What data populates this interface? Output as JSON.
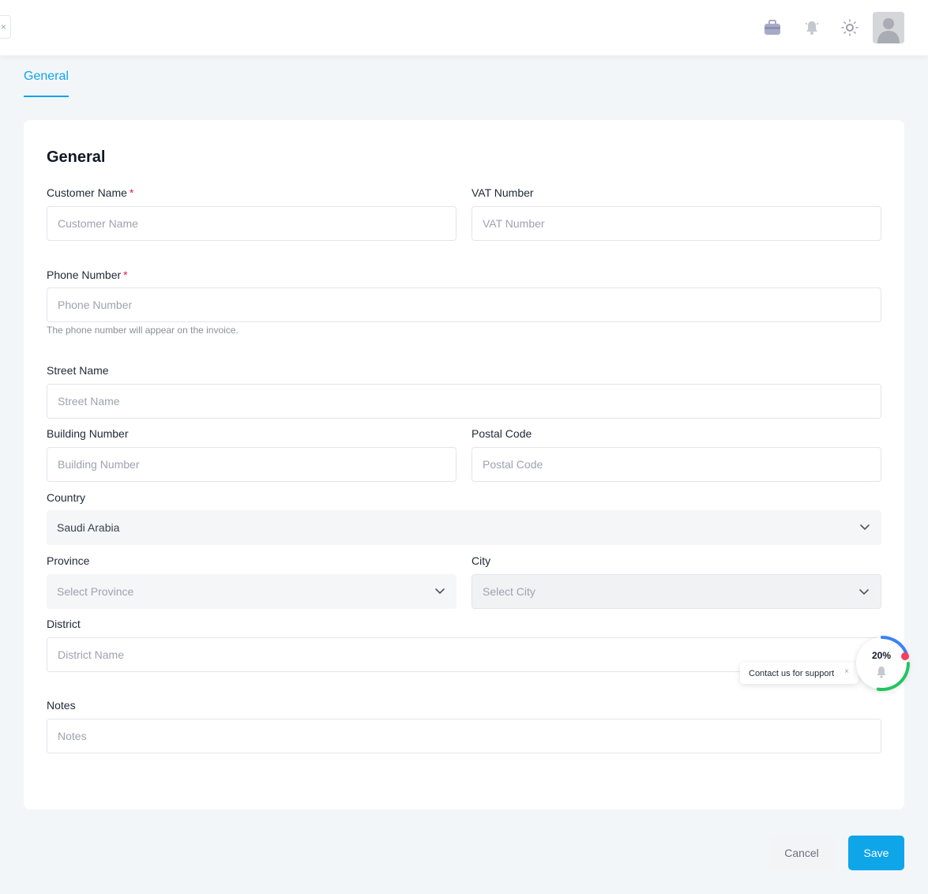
{
  "topbar": {
    "close_glyph": "×",
    "icons": [
      "briefcase-icon",
      "bell-icon",
      "sun-icon"
    ],
    "avatar": "user-avatar"
  },
  "tabs": [
    {
      "label": "General",
      "active": true
    }
  ],
  "form": {
    "title": "General",
    "customer_name": {
      "label": "Customer Name",
      "required_mark": "*",
      "placeholder": "Customer Name"
    },
    "vat_number": {
      "label": "VAT Number",
      "placeholder": "VAT Number"
    },
    "phone_number": {
      "label": "Phone Number",
      "required_mark": "*",
      "placeholder": "Phone Number",
      "hint": "The phone number will appear on the invoice."
    },
    "street_name": {
      "label": "Street Name",
      "placeholder": "Street Name"
    },
    "building_number": {
      "label": "Building Number",
      "placeholder": "Building Number"
    },
    "postal_code": {
      "label": "Postal Code",
      "placeholder": "Postal Code"
    },
    "country": {
      "label": "Country",
      "value": "Saudi Arabia"
    },
    "province": {
      "label": "Province",
      "placeholder": "Select Province"
    },
    "city": {
      "label": "City",
      "placeholder": "Select City"
    },
    "district": {
      "label": "District",
      "placeholder": "District Name"
    },
    "notes": {
      "label": "Notes",
      "placeholder": "Notes"
    }
  },
  "actions": {
    "cancel": "Cancel",
    "save": "Save"
  },
  "support": {
    "text": "Contact us for support",
    "close_glyph": "×",
    "progress_label": "20%",
    "progress": 0.2
  },
  "colors": {
    "accent": "#0ea5e9",
    "required": "#e11d48",
    "progress_green": "#22c55e",
    "progress_blue": "#3b82f6",
    "notif_dot": "#f43f5e"
  }
}
